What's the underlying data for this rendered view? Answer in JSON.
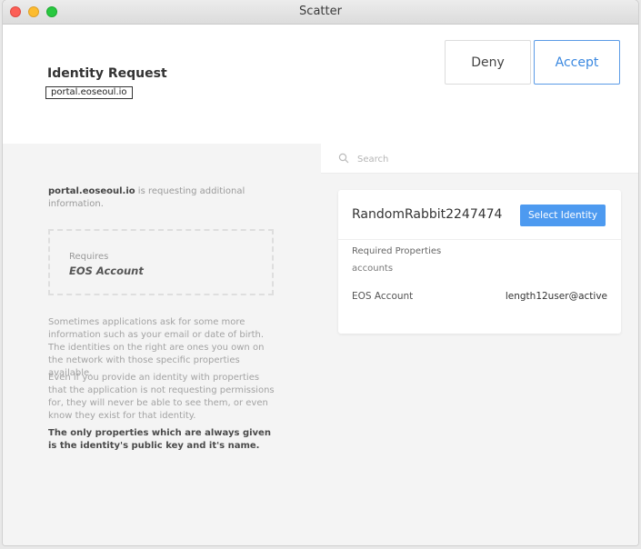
{
  "window": {
    "title": "Scatter"
  },
  "header": {
    "title": "Identity Request",
    "origin": "portal.eoseoul.io",
    "deny_label": "Deny",
    "accept_label": "Accept"
  },
  "left": {
    "origin": "portal.eoseoul.io",
    "intro_rest": " is requesting additional information.",
    "requires_label": "Requires",
    "requires_value": "EOS Account",
    "help_1": "Sometimes applications ask for some more information such as your email or date of birth. The identities on the right are ones you own on the network with those specific properties available.",
    "help_2": "Even if you provide an identity with properties that the application is not requesting permissions for, they will never be able to see them, or even know they exist for that identity.",
    "help_3": "The only properties which are always given is the identity's public key and it's name."
  },
  "search": {
    "placeholder": "Search"
  },
  "identity": {
    "name": "RandomRabbit2247474",
    "select_label": "Select Identity",
    "required_properties_label": "Required Properties",
    "required_properties_value": "accounts",
    "account_label": "EOS Account",
    "account_value": "length12user@active"
  },
  "colors": {
    "accent": "#4d9af0",
    "accept_border": "#5b9be6",
    "panel_bg": "#f4f4f4"
  },
  "icons": [
    "search-icon"
  ]
}
